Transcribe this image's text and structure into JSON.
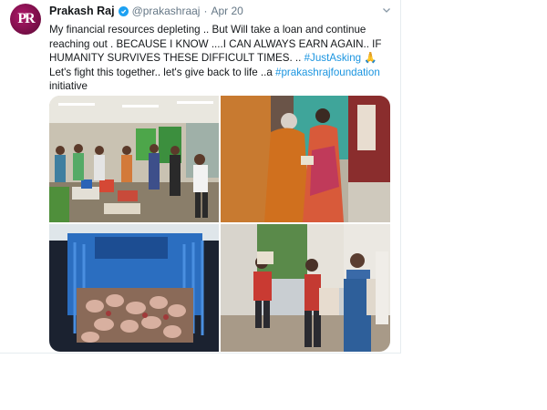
{
  "tweet": {
    "avatar_letters": "PR",
    "display_name": "Prakash Raj",
    "handle": "@prakashraaj",
    "separator": "·",
    "date": "Apr 20",
    "text_part1": "My financial resources depleting .. But Will take a loan and continue reaching out . BECAUSE I KNOW ....I CAN ALWAYS EARN AGAIN.. IF HUMANITY SURVIVES THESE DIFFICULT TIMES. .. ",
    "hashtag1": "#JustAsking",
    "emoji": "🙏",
    "text_part2": "Let's fight this together.. let's give back to life ..a ",
    "hashtag2": "#prakashrajfoundation",
    "text_part3": " initiative"
  },
  "icons": {
    "verified": "verified-badge-icon",
    "menu": "chevron-down-icon"
  },
  "colors": {
    "link": "#1b95e0",
    "verified": "#1da1f2",
    "secondary_text": "#657786",
    "primary_text": "#14171a"
  }
}
